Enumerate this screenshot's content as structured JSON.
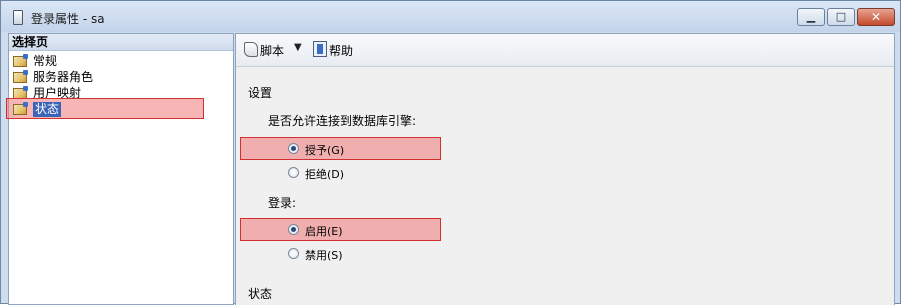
{
  "window": {
    "title": "登录属性 - sa",
    "minimize_glyph": "▁",
    "maximize_glyph": "□",
    "close_glyph": "✕"
  },
  "sidebar": {
    "header": "选择页",
    "items": [
      {
        "label": "常规",
        "selected": false
      },
      {
        "label": "服务器角色",
        "selected": false
      },
      {
        "label": "用户映射",
        "selected": false
      },
      {
        "label": "状态",
        "selected": true
      }
    ]
  },
  "toolbar": {
    "script_label": "脚本",
    "script_dropdown_glyph": "▼",
    "help_label": "帮助"
  },
  "main": {
    "settings_title": "设置",
    "connect_question": "是否允许连接到数据库引擎:",
    "connect_options": [
      {
        "label": "授予(G)",
        "checked": true
      },
      {
        "label": "拒绝(D)",
        "checked": false
      }
    ],
    "login_title": "登录:",
    "login_options": [
      {
        "label": "启用(E)",
        "checked": true
      },
      {
        "label": "禁用(S)",
        "checked": false
      }
    ],
    "status_title": "状态"
  },
  "colors": {
    "highlight_fill": "#f4a3a3",
    "highlight_border": "#d03030",
    "selection": "#3a64b7"
  }
}
